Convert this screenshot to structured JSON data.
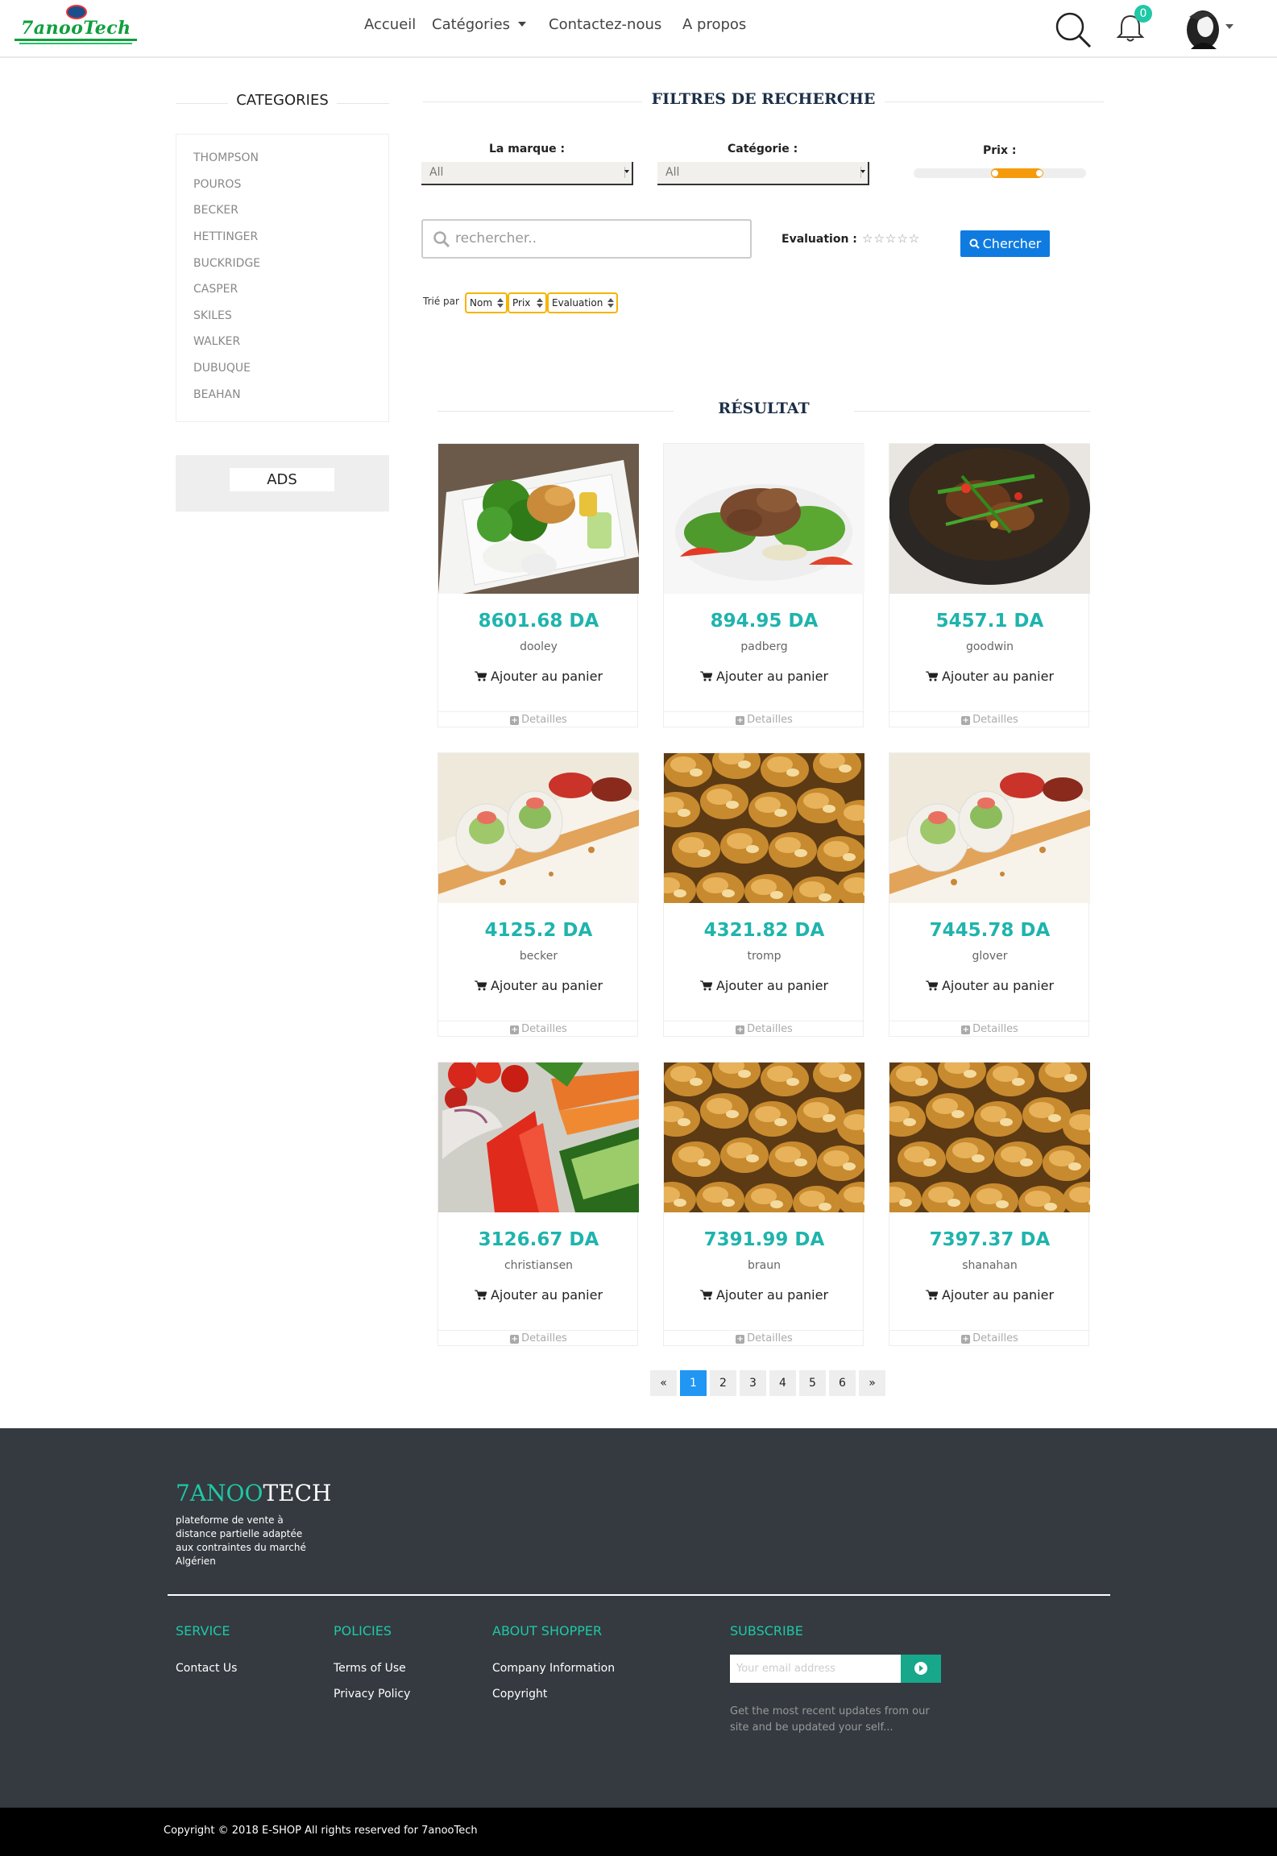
{
  "brand": {
    "logo_text": "7anooTech"
  },
  "nav": {
    "accueil": "Accueil",
    "categories": "Catégories",
    "contact": "Contactez-nous",
    "apropos": "A propos",
    "notif_count": "0"
  },
  "sidebar": {
    "title": "CATEGORIES",
    "categories": [
      "THOMPSON",
      "POUROS",
      "BECKER",
      "HETTINGER",
      "BUCKRIDGE",
      "CASPER",
      "SKILES",
      "WALKER",
      "DUBUQUE",
      "BEAHAN"
    ],
    "ads_label": "ADS"
  },
  "filters": {
    "title": "FILTRES DE RECHERCHE",
    "brand_label": "La marque :",
    "brand_value": "All",
    "category_label": "Catégorie :",
    "category_value": "All",
    "price_label": "Prix :",
    "price_range": [
      0.45,
      0.75
    ],
    "search_placeholder": "rechercher..",
    "evaluation_label": "Evaluation :",
    "stars": "☆☆☆☆☆",
    "search_button": "Chercher",
    "sort_label": "Trié par",
    "sort_options": [
      "Nom",
      "Prix",
      "Evaluation"
    ]
  },
  "results": {
    "title": "RÉSULTAT",
    "cart_label": "Ajouter au panier",
    "details_label": "Detailles",
    "products": [
      {
        "price": "8601.68 DA",
        "name": "dooley",
        "image": "bento-box"
      },
      {
        "price": "894.95 DA",
        "name": "padberg",
        "image": "beef-salad"
      },
      {
        "price": "5457.1 DA",
        "name": "goodwin",
        "image": "claypot-stew"
      },
      {
        "price": "4125.2 DA",
        "name": "becker",
        "image": "spring-rolls"
      },
      {
        "price": "4321.82 DA",
        "name": "tromp",
        "image": "bread-rolls"
      },
      {
        "price": "7445.78 DA",
        "name": "glover",
        "image": "spring-rolls"
      },
      {
        "price": "3126.67 DA",
        "name": "christiansen",
        "image": "vegetables"
      },
      {
        "price": "7391.99 DA",
        "name": "braun",
        "image": "bread-rolls"
      },
      {
        "price": "7397.37 DA",
        "name": "shanahan",
        "image": "bread-rolls"
      }
    ]
  },
  "pagination": {
    "items": [
      "«",
      "1",
      "2",
      "3",
      "4",
      "5",
      "6",
      "»"
    ],
    "active": "1"
  },
  "footer": {
    "brand_part1": "7ANOO",
    "brand_part2": "TECH",
    "description": "plateforme de vente à distance partielle adaptée aux contraintes du marché Algérien",
    "service_head": "SERVICE",
    "service_links": [
      "Contact Us"
    ],
    "policies_head": "POLICIES",
    "policies_links": [
      "Terms of Use",
      "Privacy Policy"
    ],
    "about_head": "ABOUT SHOPPER",
    "about_links": [
      "Company Information",
      "Copyright"
    ],
    "subscribe_head": "SUBSCRIBE",
    "email_placeholder": "Your email address",
    "subscribe_note": "Get the most recent updates from our site and be updated your self...",
    "copyright": "Copyright © 2018 E-SHOP All rights reserved for 7anooTech"
  },
  "colors": {
    "accent": "#1fb4ad",
    "button_blue": "#0f7be0",
    "slider": "#f59a0c",
    "footer_bg": "#343a40",
    "footer_accent": "#1fc8a6"
  }
}
